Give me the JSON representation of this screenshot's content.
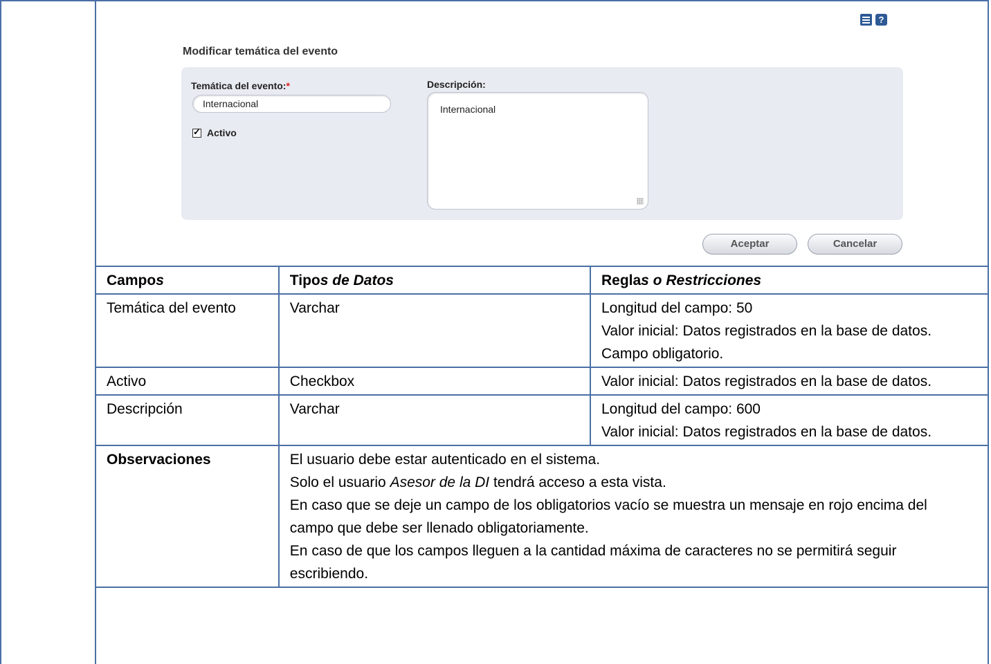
{
  "icons": [
    "list-icon",
    "help-icon"
  ],
  "form": {
    "title": "Modificar temática del evento",
    "tematica_label": "Temática del evento:",
    "required_mark": "*",
    "tematica_value": "Internacional",
    "activo_label": "Activo",
    "activo_checked": true,
    "descripcion_label": "Descripción:",
    "descripcion_value": "Internacional",
    "accept_label": "Aceptar",
    "cancel_label": "Cancelar"
  },
  "table": {
    "headers": {
      "campos_bold": "Campo",
      "campos_italic": "s",
      "tipos_bold": "Tipo",
      "tipos_italic": "s de Datos",
      "reglas_bold": "Regla",
      "reglas_italic": "s o Restricciones"
    },
    "rows": [
      {
        "field": "Temática  del evento",
        "type": "Varchar",
        "rules": [
          "Longitud del campo: 50",
          "Valor inicial: Datos registrados  en la base de datos.",
          "Campo obligatorio."
        ]
      },
      {
        "field": "Activo",
        "type": "Checkbox",
        "rules": [
          "Valor inicial: Datos registrados  en la base de datos."
        ]
      },
      {
        "field": "Descripción",
        "type": "Varchar",
        "rules": [
          "Longitud del campo: 600",
          "Valor inicial: Datos registrados  en la base de datos."
        ]
      }
    ],
    "observaciones": {
      "label": "Observaciones",
      "lines": [
        "El usuario debe estar autenticado en el sistema.",
        "Solo el usuario ",
        "Asesor de la DI",
        " tendrá acceso a esta vista.",
        "En caso que se deje un campo de los obligatorios vacío se muestra un mensaje en rojo encima del campo que debe ser llenado obligatoriamente.",
        "En caso de que los campos lleguen a la cantidad máxima de caracteres no se permitirá  seguir escribiendo."
      ]
    }
  }
}
